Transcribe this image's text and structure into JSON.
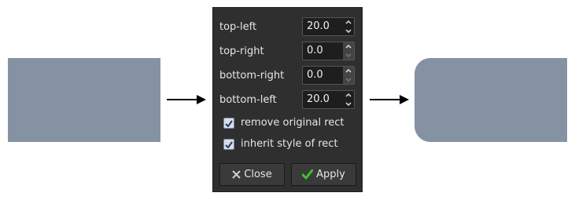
{
  "colors": {
    "rect": "#8592a3",
    "dialog_bg": "#2f2f2f",
    "check_bg": "#d8dde6",
    "apply_icon": "#3ec62f"
  },
  "dialog": {
    "fields": [
      {
        "label": "top-left",
        "value": "20.0"
      },
      {
        "label": "top-right",
        "value": "0.0"
      },
      {
        "label": "bottom-right",
        "value": "0.0"
      },
      {
        "label": "bottom-left",
        "value": "20.0"
      }
    ],
    "options": [
      {
        "label": "remove original rect",
        "checked": true
      },
      {
        "label": "inherit style of rect",
        "checked": true
      }
    ],
    "buttons": {
      "close": "Close",
      "apply": "Apply"
    }
  },
  "icons": {
    "arrow": "arrow-right-icon",
    "close": "close-x-icon",
    "apply": "checkmark-icon",
    "spin_up": "chevron-up-icon",
    "spin_down": "chevron-down-icon",
    "checkbox": "checkbox-checked-icon"
  }
}
